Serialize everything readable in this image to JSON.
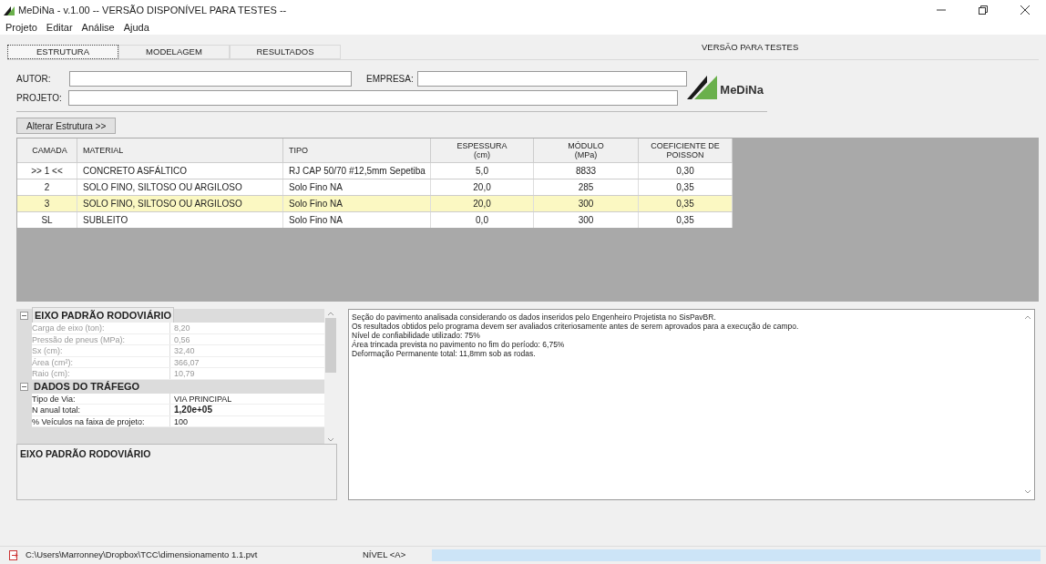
{
  "window": {
    "title": "MeDiNa - v.1.00 -- VERSÃO DISPONÍVEL PARA TESTES --"
  },
  "menu": [
    {
      "label": "Projeto"
    },
    {
      "label": "Editar"
    },
    {
      "label": "Análise"
    },
    {
      "label": "Ajuda"
    }
  ],
  "tabs": [
    {
      "label": "ESTRUTURA",
      "selected": true
    },
    {
      "label": "MODELAGEM",
      "selected": false
    },
    {
      "label": "RESULTADOS",
      "selected": false
    }
  ],
  "version_label": "VERSÃO PARA TESTES",
  "form": {
    "autor_label": "AUTOR:",
    "empresa_label": "EMPRESA:",
    "projeto_label": "PROJETO:"
  },
  "logo_text": "MeDiNa",
  "alter_button": "Alterar Estrutura >>",
  "table": {
    "columns": [
      "CAMADA",
      "MATERIAL",
      "TIPO",
      "ESPESSURA\n(cm)",
      "MÓDULO\n(MPa)",
      "COEFICIENTE DE\nPOISSON"
    ],
    "rows": [
      {
        "cells": [
          ">> 1 <<",
          "CONCRETO ASFÁLTICO",
          "RJ CAP 50/70 #12,5mm Sepetiba",
          "5,0",
          "8833",
          "0,30"
        ],
        "selected": false
      },
      {
        "cells": [
          "2",
          "SOLO FINO, SILTOSO OU ARGILOSO",
          "Solo Fino NA",
          "20,0",
          "285",
          "0,35"
        ],
        "selected": false
      },
      {
        "cells": [
          "3",
          "SOLO FINO, SILTOSO OU ARGILOSO",
          "Solo Fino NA",
          "20,0",
          "300",
          "0,35"
        ],
        "selected": true
      },
      {
        "cells": [
          "SL",
          "SUBLEITO",
          "Solo Fino NA",
          "0,0",
          "300",
          "0,35"
        ],
        "selected": false
      }
    ]
  },
  "properties": [
    {
      "category": "EIXO PADRÃO RODOVIÁRIO",
      "expanded": true,
      "selected": true,
      "items": [
        {
          "name": "Carga de eixo (ton):",
          "value": "8,20",
          "disabled": true,
          "bold": false
        },
        {
          "name": "Pressão de pneus (MPa):",
          "value": "0,56",
          "disabled": true,
          "bold": false
        },
        {
          "name": "Sx (cm):",
          "value": "32,40",
          "disabled": true,
          "bold": false
        },
        {
          "name": "Área (cm²):",
          "value": "366,07",
          "disabled": true,
          "bold": false
        },
        {
          "name": "Raio (cm):",
          "value": "10,79",
          "disabled": true,
          "bold": false
        }
      ]
    },
    {
      "category": "DADOS DO TRÁFEGO",
      "expanded": true,
      "selected": false,
      "items": [
        {
          "name": "Tipo de Via:",
          "value": "VIA PRINCIPAL",
          "disabled": false,
          "bold": false
        },
        {
          "name": "N anual total:",
          "value": "1,20e+05",
          "disabled": false,
          "bold": true
        },
        {
          "name": "% Veículos na faixa de projeto:",
          "value": "100",
          "disabled": false,
          "bold": false
        }
      ]
    }
  ],
  "description_title": "EIXO PADRÃO RODOVIÁRIO",
  "output_lines": [
    "Seção do pavimento analisada considerando os dados inseridos pelo Engenheiro Projetista no SisPavBR.",
    "Os resultados obtidos pelo programa devem ser avaliados criteriosamente antes de serem aprovados para a execução de campo.",
    "Nível de confiabilidade utilizado: 75%",
    "Área trincada prevista no pavimento no fim do período: 6,75%",
    "Deformação Permanente total: 11,8mm sob as rodas."
  ],
  "status_bar": {
    "path": "C:\\Users\\Marronney\\Dropbox\\TCC\\dimensionamento 1.1.pvt",
    "level_label": "NÍVEL <A>",
    "progress": {
      "level": 1
    }
  }
}
